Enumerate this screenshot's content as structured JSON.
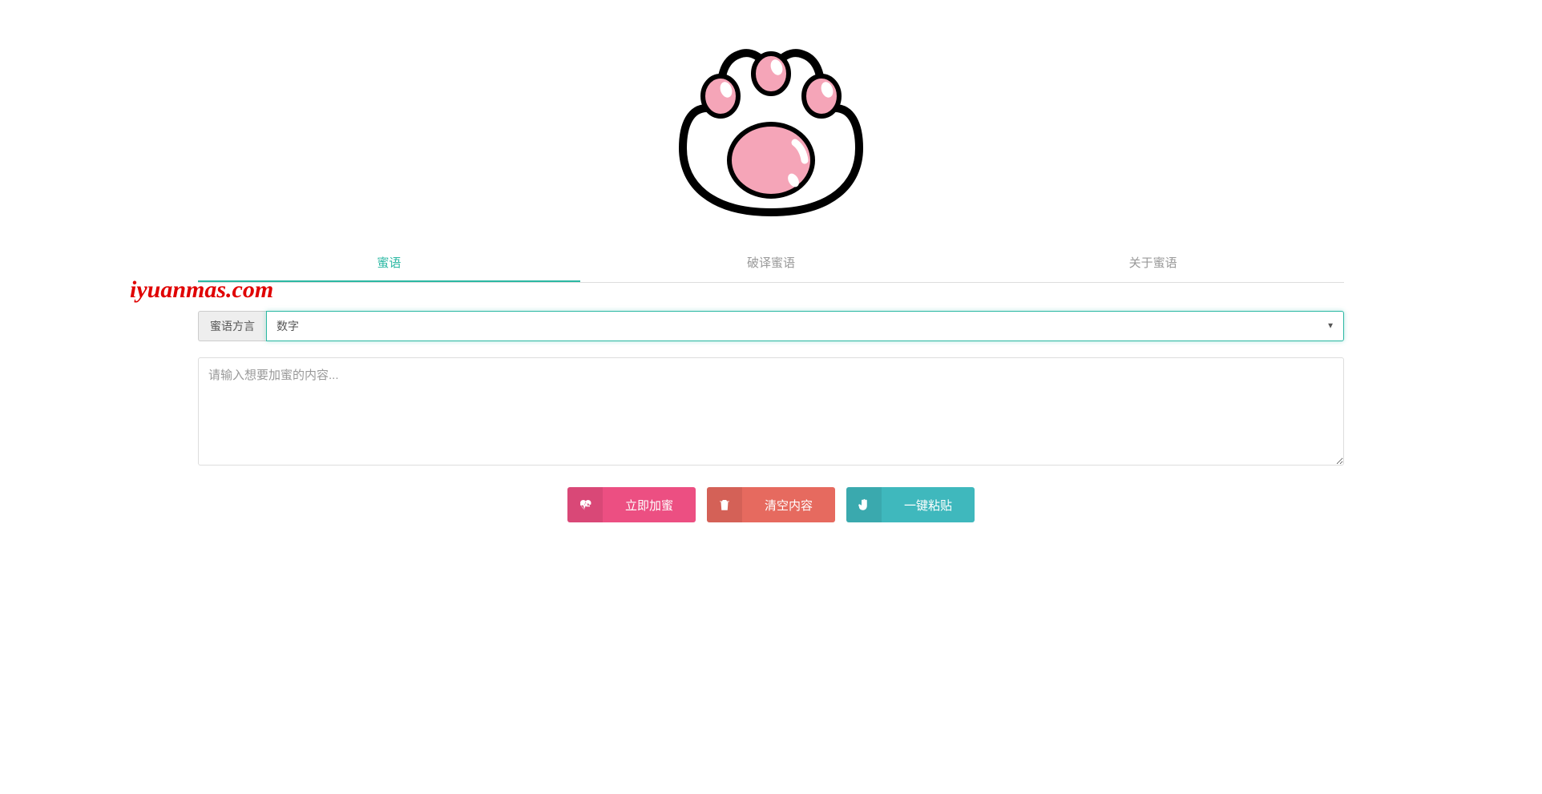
{
  "watermark": "iyuanmas.com",
  "tabs": {
    "items": [
      {
        "label": "蜜语",
        "active": true
      },
      {
        "label": "破译蜜语",
        "active": false
      },
      {
        "label": "关于蜜语",
        "active": false
      }
    ]
  },
  "form": {
    "dialect_label": "蜜语方言",
    "select_value": "数字",
    "textarea_placeholder": "请输入想要加蜜的内容..."
  },
  "buttons": {
    "encrypt": "立即加蜜",
    "clear": "清空内容",
    "paste": "一键粘贴"
  }
}
